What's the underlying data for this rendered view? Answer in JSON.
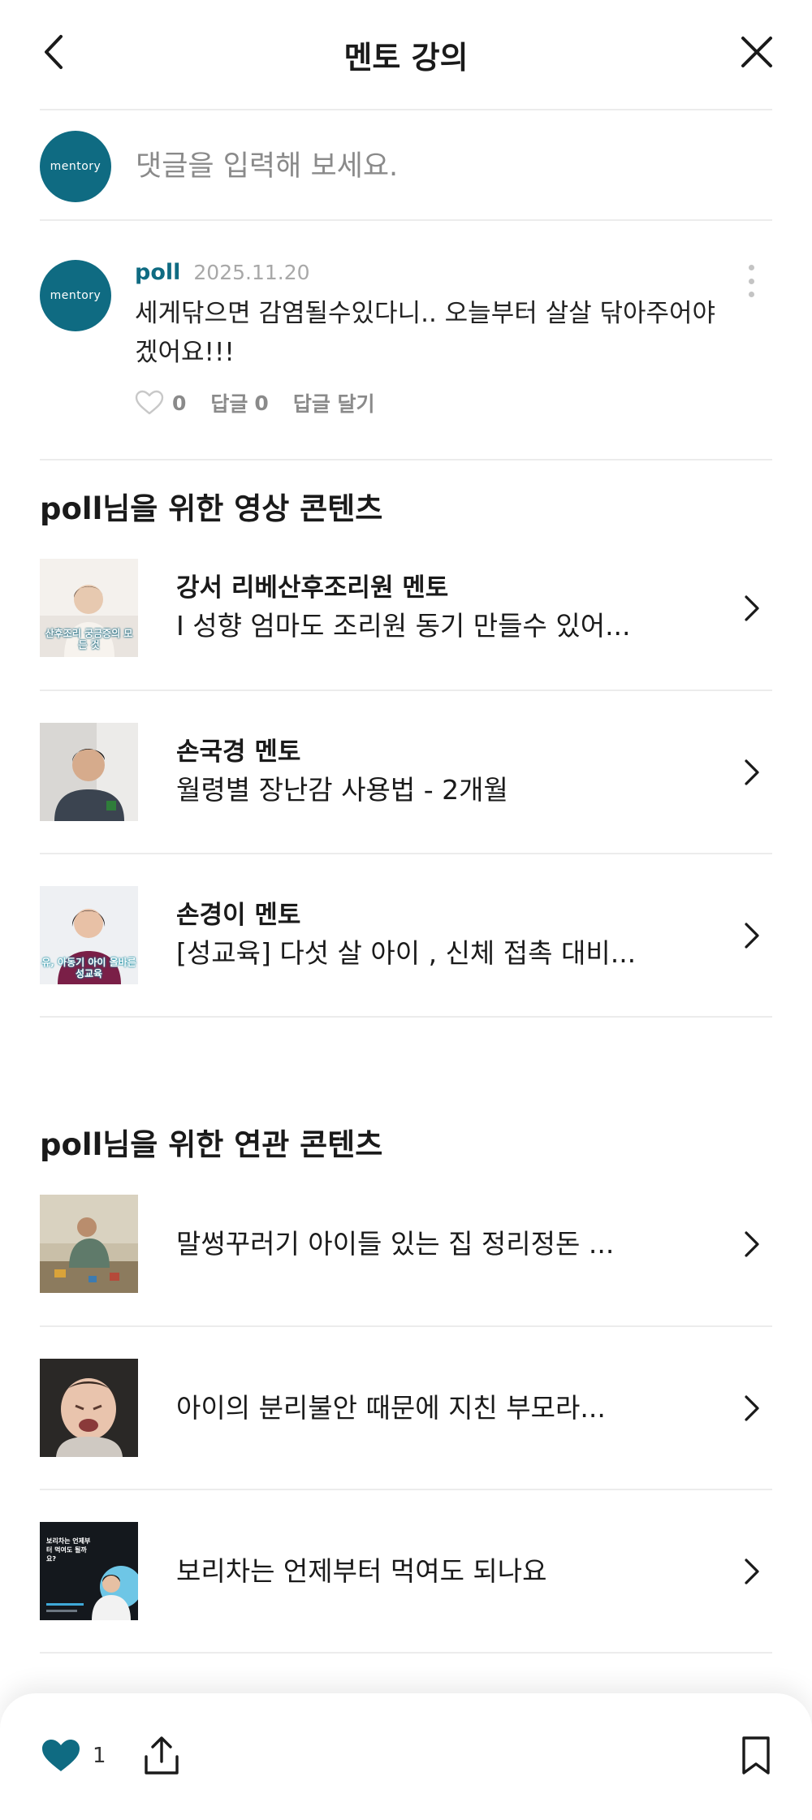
{
  "header": {
    "title": "멘토 강의"
  },
  "comment_input": {
    "placeholder": "댓글을 입력해 보세요.",
    "avatar_logo": "mentory"
  },
  "comment": {
    "avatar_logo": "mentory",
    "user": "poll",
    "date": "2025.11.20",
    "text": "세게닦으면 감염될수있다니.. 오늘부터 살살 닦아주어야겠어요!!!",
    "like_count": "0",
    "reply_label": "답글",
    "reply_count": "0",
    "reply_write": "답글 달기"
  },
  "video_section": {
    "title": "poll님을 위한 영상 콘텐츠",
    "items": [
      {
        "mentor": "강서 리베산후조리원 멘토",
        "title": "I 성향 엄마도 조리원 동기 만들수 있어...",
        "thumb_caption": "산후조리 궁금증의 모든 것"
      },
      {
        "mentor": "손국경 멘토",
        "title": "월령별 장난감 사용법 - 2개월"
      },
      {
        "mentor": "손경이 멘토",
        "title": "[성교육] 다섯 살 아이 , 신체 접촉 대비...",
        "thumb_caption": "유, 아동기 아이 올바른 성교육"
      }
    ]
  },
  "related_section": {
    "title": "poll님을 위한 연관 콘텐츠",
    "items": [
      {
        "title": "말썽꾸러기 아이들 있는 집 정리정돈 ..."
      },
      {
        "title": "아이의 분리불안 때문에 지친 부모라..."
      },
      {
        "title": "보리차는 언제부터 먹여도 되나요",
        "thumb_caption": "보리차는 언제부터 먹여도 될까요?"
      }
    ]
  },
  "bottom_bar": {
    "like_count": "1"
  },
  "colors": {
    "brand": "#0f6b82",
    "heart": "#0f6b82",
    "divider": "#ececec"
  }
}
